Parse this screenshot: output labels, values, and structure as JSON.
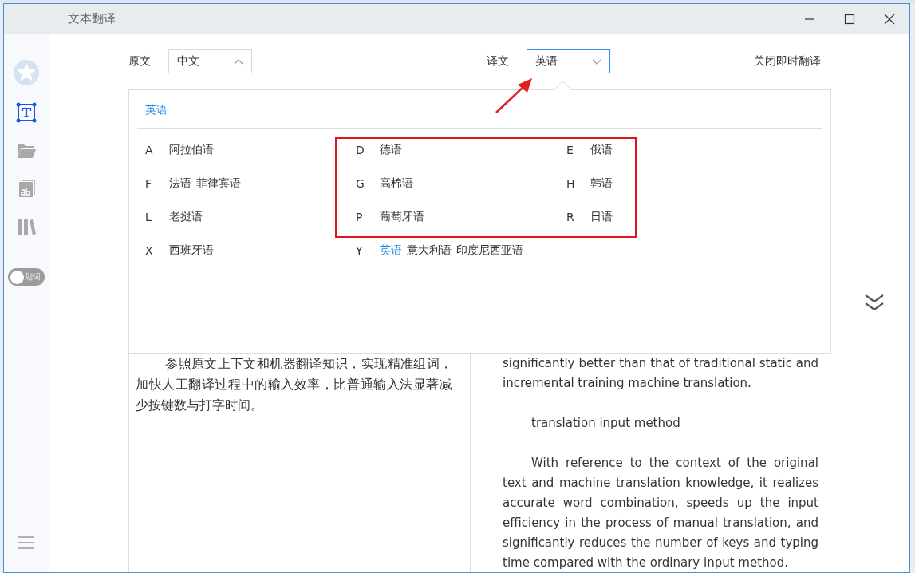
{
  "window": {
    "title": "文本翻译"
  },
  "sidebar": {
    "tools": [
      {
        "kind": "text",
        "selected": true
      },
      {
        "kind": "folder",
        "selected": false
      },
      {
        "kind": "document",
        "selected": false
      },
      {
        "kind": "library",
        "selected": false
      }
    ],
    "toggle": {
      "label": "划词",
      "on": false
    }
  },
  "header": {
    "source": {
      "label": "原文",
      "value": "中文",
      "expanded": true
    },
    "target": {
      "label": "译文",
      "value": "英语",
      "expanded": false,
      "focused": true
    },
    "instant_link": "关闭即时翻译"
  },
  "language_panel": {
    "current": "英语",
    "groups": [
      {
        "letter": "A",
        "languages": [
          {
            "name": "阿拉伯语",
            "selected": false
          }
        ]
      },
      {
        "letter": "D",
        "languages": [
          {
            "name": "德语",
            "selected": false
          }
        ]
      },
      {
        "letter": "E",
        "languages": [
          {
            "name": "俄语",
            "selected": false
          }
        ]
      },
      {
        "letter": "F",
        "languages": [
          {
            "name": "法语",
            "selected": false
          },
          {
            "name": "菲律宾语",
            "selected": false
          }
        ]
      },
      {
        "letter": "G",
        "languages": [
          {
            "name": "高棉语",
            "selected": false
          }
        ]
      },
      {
        "letter": "H",
        "languages": [
          {
            "name": "韩语",
            "selected": false
          }
        ]
      },
      {
        "letter": "L",
        "languages": [
          {
            "name": "老挝语",
            "selected": false
          }
        ]
      },
      {
        "letter": "P",
        "languages": [
          {
            "name": "葡萄牙语",
            "selected": false
          }
        ]
      },
      {
        "letter": "R",
        "languages": [
          {
            "name": "日语",
            "selected": false
          }
        ]
      },
      {
        "letter": "X",
        "languages": [
          {
            "name": "西班牙语",
            "selected": false
          }
        ]
      },
      {
        "letter": "Y",
        "languages": [
          {
            "name": "英语",
            "selected": true
          },
          {
            "name": "意大利语",
            "selected": false
          },
          {
            "name": "印度尼西亚语",
            "selected": false
          }
        ]
      }
    ]
  },
  "source_text": [
    "参照原文上下文和机器翻译知识，实现精准组词，加快人工翻译过程中的输入效率，比普通输入法显著减少按键数与打字时间。"
  ],
  "translation_text": [
    {
      "text": "significantly better than that of traditional static and incremental training machine translation.",
      "indent": false
    },
    {
      "text": "translation input method",
      "indent": true
    },
    {
      "text": "With reference to the context of the original text and machine translation knowledge, it realizes accurate word combination, speeds up the input efficiency in the process of manual translation, and significantly reduces the number of keys and typing time compared with the ordinary input method.",
      "indent": true
    }
  ]
}
